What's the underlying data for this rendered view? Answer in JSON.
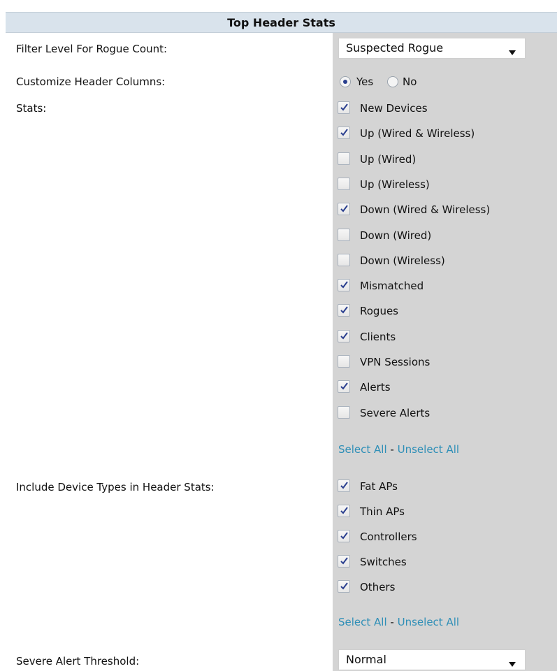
{
  "header": {
    "title": "Top Header Stats"
  },
  "rogue_filter": {
    "label": "Filter Level For Rogue Count:",
    "value": "Suspected Rogue"
  },
  "customize": {
    "label": "Customize Header Columns:",
    "yes": "Yes",
    "no": "No",
    "selected": "Yes"
  },
  "stats": {
    "label": "Stats:",
    "items": [
      {
        "label": "New Devices",
        "checked": true
      },
      {
        "label": "Up (Wired & Wireless)",
        "checked": true
      },
      {
        "label": "Up (Wired)",
        "checked": false
      },
      {
        "label": "Up (Wireless)",
        "checked": false
      },
      {
        "label": "Down (Wired & Wireless)",
        "checked": true
      },
      {
        "label": "Down (Wired)",
        "checked": false
      },
      {
        "label": "Down (Wireless)",
        "checked": false
      },
      {
        "label": "Mismatched",
        "checked": true
      },
      {
        "label": "Rogues",
        "checked": true
      },
      {
        "label": "Clients",
        "checked": true
      },
      {
        "label": "VPN Sessions",
        "checked": false
      },
      {
        "label": "Alerts",
        "checked": true
      },
      {
        "label": "Severe Alerts",
        "checked": false
      }
    ],
    "select_all": "Select All",
    "separator": "-",
    "unselect_all": "Unselect All"
  },
  "device_types": {
    "label": "Include Device Types in Header Stats:",
    "items": [
      {
        "label": "Fat APs",
        "checked": true
      },
      {
        "label": "Thin APs",
        "checked": true
      },
      {
        "label": "Controllers",
        "checked": true
      },
      {
        "label": "Switches",
        "checked": true
      },
      {
        "label": "Others",
        "checked": true
      }
    ],
    "select_all": "Select All",
    "separator": "-",
    "unselect_all": "Unselect All"
  },
  "severe_threshold": {
    "label": "Severe Alert Threshold:",
    "value": "Normal"
  },
  "colors": {
    "link": "#2f8fb7",
    "right_column_bg": "#d4d4d4",
    "header_bg": "#d9e3ec",
    "check": "#2a3f8f"
  },
  "icons": {
    "dropdown": "chevron-down-icon",
    "check": "checkmark-icon"
  }
}
